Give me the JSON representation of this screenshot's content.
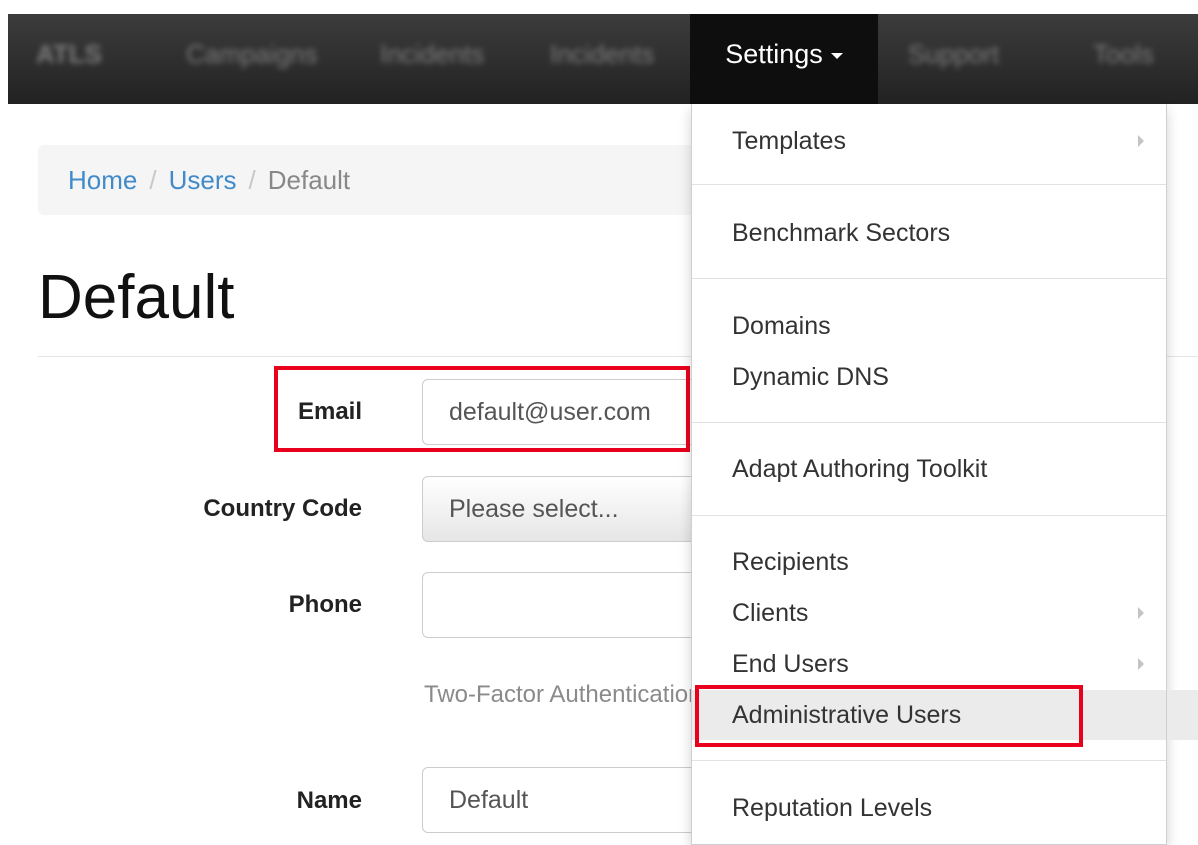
{
  "navbar": {
    "brand": "ATLS",
    "items": [
      "Campaigns",
      "Incidents",
      "Incidents"
    ],
    "settings_label": "Settings",
    "right_items": [
      "Support",
      "Tools"
    ]
  },
  "breadcrumb": {
    "home": "Home",
    "users": "Users",
    "current": "Default",
    "separator": "/"
  },
  "page": {
    "title": "Default"
  },
  "form": {
    "email_label": "Email",
    "email_value": "default@user.com",
    "country_code_label": "Country Code",
    "country_code_value": "Please select...",
    "phone_label": "Phone",
    "phone_value": "",
    "two_factor_text": "Two-Factor Authentication",
    "name_label": "Name",
    "name_value": "Default"
  },
  "settings_menu": {
    "templates": "Templates",
    "benchmark_sectors": "Benchmark Sectors",
    "domains": "Domains",
    "dynamic_dns": "Dynamic DNS",
    "adapt_authoring_toolkit": "Adapt Authoring Toolkit",
    "recipients": "Recipients",
    "clients": "Clients",
    "end_users": "End Users",
    "administrative_users": "Administrative Users",
    "reputation_levels": "Reputation Levels"
  },
  "colors": {
    "highlight_box": "#e8001c",
    "link": "#428bca",
    "navbar": "#222222"
  }
}
